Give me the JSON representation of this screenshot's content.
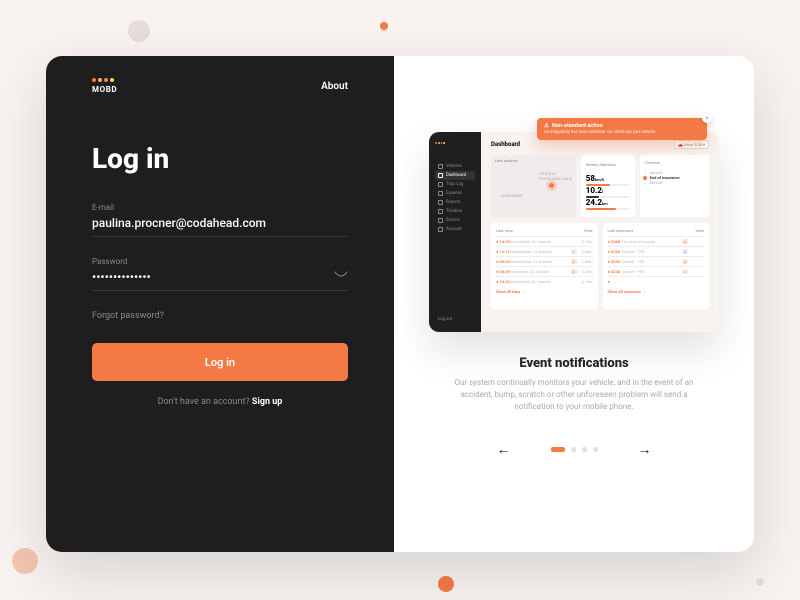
{
  "brand": {
    "name": "MOBD",
    "dot_colors": [
      "#f47a45",
      "#ffb24a",
      "#ff7a7a",
      "#ffd83a"
    ]
  },
  "nav": {
    "about": "About"
  },
  "login": {
    "heading": "Log in",
    "email_label": "E-mail",
    "email_value": "paulina.procner@codahead.com",
    "password_label": "Password",
    "password_value": "••••••••••••••",
    "forgot": "Forgot password?",
    "submit": "Log in",
    "signup_prompt": "Don't have an account? ",
    "signup_cta": "Sign up"
  },
  "promo": {
    "title": "Event notifications",
    "subtitle": "Our system continually monitors your vehicle, and in the event of an accident, bump, scratch or other unforeseen problem will send a notification to your mobile phone.",
    "toast_title": "Non-standard action",
    "toast_body": "An irregularity has been detected. Go check out your vehicle.",
    "page_index": 0,
    "page_count": 4
  },
  "preview": {
    "header_title": "Dashboard",
    "filter_label": "Bmw 328i",
    "sidebar": [
      {
        "label": "Vehicles",
        "active": false
      },
      {
        "label": "Dashboard",
        "active": true
      },
      {
        "label": "Trips Log",
        "active": false
      },
      {
        "label": "Expense",
        "active": false
      },
      {
        "label": "Reports",
        "active": false
      },
      {
        "label": "Timeline",
        "active": false
      },
      {
        "label": "Service",
        "active": false
      },
      {
        "label": "Account",
        "active": false
      }
    ],
    "logout": "Log out",
    "map": {
      "label": "Last position",
      "loc1": "OSIEDLE PODWAWELSKIE",
      "loc2": "LUDWINÓW"
    },
    "stats": {
      "label": "Weekly Statistics",
      "items": [
        {
          "value": "58",
          "unit": "km/h",
          "pct": 55,
          "color": "#f47a45"
        },
        {
          "value": "10.2",
          "unit": "l",
          "pct": 30,
          "color": "#333"
        },
        {
          "value": "24.2",
          "unit": "km",
          "pct": 70,
          "color": "#f47a45"
        }
      ]
    },
    "timeline": {
      "label": "Timeline",
      "items": [
        {
          "text": "Service",
          "active": false
        },
        {
          "text": "End of insurance",
          "active": true
        },
        {
          "text": "Service",
          "active": false
        }
      ]
    },
    "trips": {
      "label": "Last trips",
      "view_label": "View",
      "rows": [
        {
          "time": "14:23",
          "desc": "Szlachecka 32, Kraków",
          "dist": "4.1km",
          "badge": ""
        },
        {
          "time": "12:12",
          "desc": "Kalwaryjska 14, Kraków",
          "dist": "2.8km",
          "badge": "gray"
        },
        {
          "time": "09:23",
          "desc": "Kalwaryjska 14, Kraków",
          "dist": "2.8km",
          "badge": "orange"
        },
        {
          "time": "08:39",
          "desc": "Kapelanka 22, Kraków",
          "dist": "4.2km",
          "badge": "orange"
        },
        {
          "time": "23:23",
          "desc": "Szlachecka 32, Kraków",
          "dist": "4.1km",
          "badge": ""
        }
      ],
      "footer": "Show all trips →"
    },
    "expenses": {
      "label": "Last expenses",
      "view_label": "View",
      "rows": [
        {
          "amount": "$268",
          "desc": "Tire and oil change",
          "badge": "orange"
        },
        {
          "amount": "$225",
          "desc": "Carfuel - F95",
          "badge": "gray"
        },
        {
          "amount": "$235",
          "desc": "Carfuel - F95",
          "badge": "orange"
        },
        {
          "amount": "$238",
          "desc": "Carfuel - F95",
          "badge": "gray"
        },
        {
          "amount": "",
          "desc": "",
          "badge": ""
        }
      ],
      "footer": "Show all expenses →"
    }
  }
}
